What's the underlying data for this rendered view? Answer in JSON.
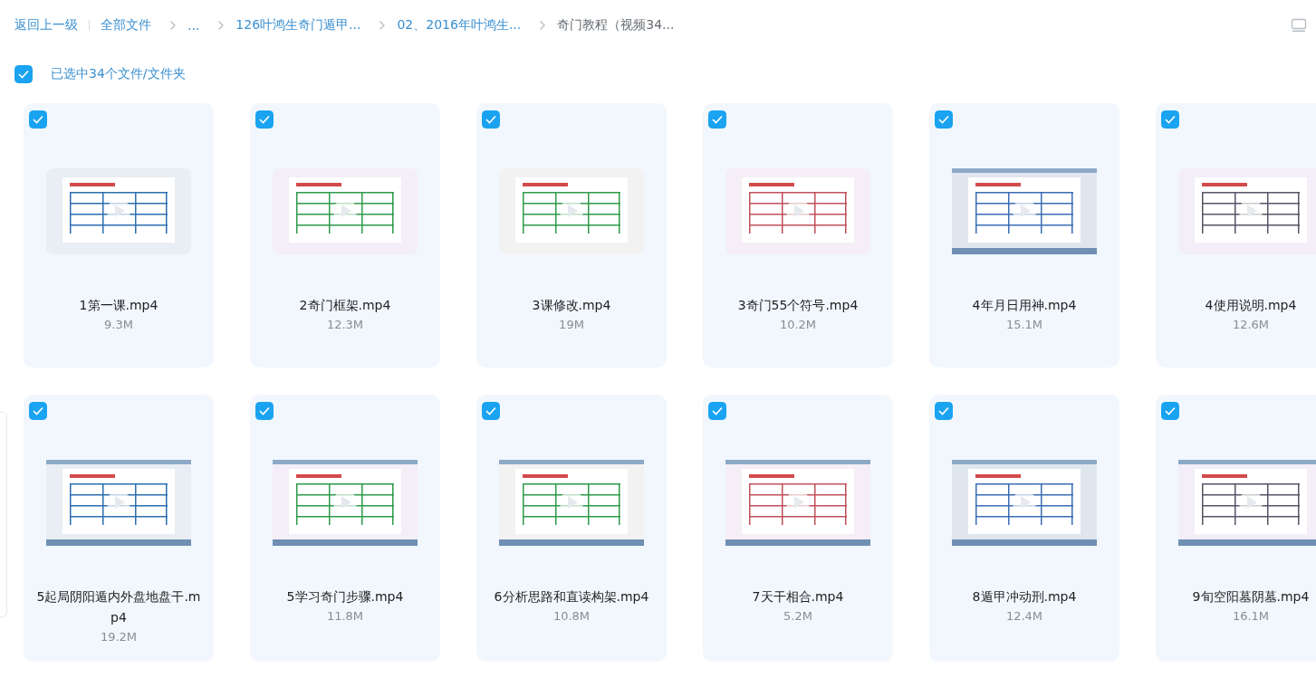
{
  "breadcrumb": {
    "back": "返回上一级",
    "items": [
      {
        "label": "全部文件",
        "kind": "link"
      },
      {
        "label": "...",
        "kind": "link"
      },
      {
        "label": "126叶鸿生奇门遁甲...",
        "kind": "link"
      },
      {
        "label": "02、2016年叶鸿生...",
        "kind": "link"
      },
      {
        "label": "奇门教程（视频34...",
        "kind": "current"
      }
    ]
  },
  "selection": {
    "checked": true,
    "label": "已选中34个文件/文件夹"
  },
  "files": [
    {
      "name": "1第一课.mp4",
      "size": "9.3M",
      "selected": true
    },
    {
      "name": "2奇门框架.mp4",
      "size": "12.3M",
      "selected": true
    },
    {
      "name": "3课修改.mp4",
      "size": "19M",
      "selected": true
    },
    {
      "name": "3奇门55个符号.mp4",
      "size": "10.2M",
      "selected": true
    },
    {
      "name": "4年月日用神.mp4",
      "size": "15.1M",
      "selected": true
    },
    {
      "name": "4使用说明.mp4",
      "size": "12.6M",
      "selected": true
    },
    {
      "name": "5起局阴阳遁内外盘地盘干.mp4",
      "size": "19.2M",
      "selected": true
    },
    {
      "name": "5学习奇门步骤.mp4",
      "size": "11.8M",
      "selected": true
    },
    {
      "name": "6分析思路和直读构架.mp4",
      "size": "10.8M",
      "selected": true
    },
    {
      "name": "7天干相合.mp4",
      "size": "5.2M",
      "selected": true
    },
    {
      "name": "8遁甲冲动刑.mp4",
      "size": "12.4M",
      "selected": true
    },
    {
      "name": "9旬空阳墓阴墓.mp4",
      "size": "16.1M",
      "selected": true
    }
  ]
}
